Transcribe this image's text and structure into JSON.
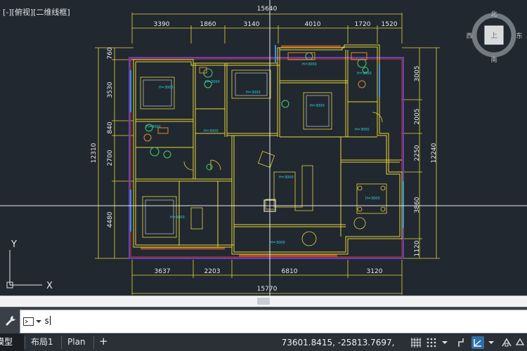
{
  "viewport": {
    "label": "[-][俯视][二维线框]",
    "viewcube": {
      "north": "北",
      "south": "南",
      "west": "西",
      "east": "东",
      "face": "上"
    }
  },
  "drawing": {
    "dims_top": {
      "overall": "15640",
      "segments": [
        "3390",
        "1860",
        "3140",
        "4010",
        "1720",
        "1520"
      ]
    },
    "dims_bottom": {
      "overall": "15770",
      "segments": [
        "3637",
        "2203",
        "6810",
        "3120"
      ]
    },
    "dims_left": {
      "overall": "12310",
      "segments": [
        "760",
        "3530",
        "840",
        "2700",
        "4480"
      ]
    },
    "dims_right": {
      "overall": "12240",
      "segments": [
        "3005",
        "2005",
        "2250",
        "3860",
        "1120"
      ]
    },
    "room_tags": [
      "H=3000",
      "H=3000",
      "H=3000",
      "H=3000",
      "H=3000",
      "H=3000",
      "H=3000",
      "H=3000",
      "H=3000",
      "H=3000",
      "H=3000",
      "H=3000",
      "H=3000"
    ]
  },
  "ucs": {
    "x_label": "X",
    "y_label": "Y"
  },
  "command_line": {
    "input_value": "s"
  },
  "status": {
    "tabs": [
      "模型",
      "布局1",
      "Plan"
    ],
    "add_tab": "+",
    "coordinates": "73601.8415, -25813.7697, 0.0000",
    "buttons": [
      "grid-icon",
      "snap-icon",
      "dropdown-icon",
      "ortho-icon",
      "polar-icon",
      "osnap-icon",
      "isodraft-icon"
    ]
  },
  "colors": {
    "background": "#212830",
    "wall": "#e9d638",
    "dimension": "#e9d638",
    "dim_text": "#eaeaea",
    "room_tag": "#27d4e6",
    "crosshair": "#e8e8e8",
    "status_bar": "#2b3036",
    "accent": "#2f6fa8"
  }
}
